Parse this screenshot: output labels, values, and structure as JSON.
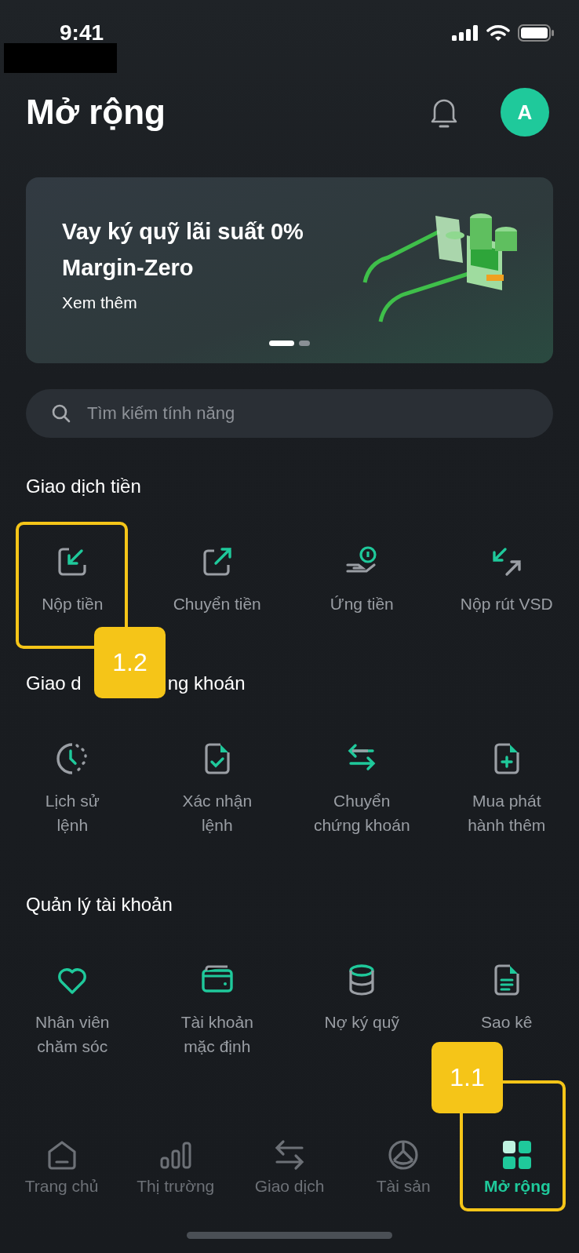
{
  "status_bar": {
    "time": "9:41"
  },
  "header": {
    "title": "Mở rộng",
    "avatar": "A"
  },
  "banner": {
    "title": "Vay ký quỹ lãi suất 0%",
    "subtitle": "Margin-Zero",
    "link": "Xem thêm",
    "pages": [
      {
        "selected": true
      },
      {
        "selected": false
      }
    ]
  },
  "search": {
    "placeholder": "Tìm kiếm tính năng"
  },
  "sections": [
    {
      "title_parts": [
        "Giao dịch tiền"
      ],
      "items": [
        {
          "lines": [
            "Nộp tiền"
          ]
        },
        {
          "lines": [
            "Chuyển tiền"
          ]
        },
        {
          "lines": [
            "Ứng tiền"
          ]
        },
        {
          "lines": [
            "Nộp rút VSD"
          ]
        }
      ]
    },
    {
      "title_parts": [
        "Giao d",
        "ng khoán"
      ],
      "items": [
        {
          "lines": [
            "Lịch sử",
            "lệnh"
          ]
        },
        {
          "lines": [
            "Xác nhận",
            "lệnh"
          ]
        },
        {
          "lines": [
            "Chuyển",
            "chứng khoán"
          ]
        },
        {
          "lines": [
            "Mua phát",
            "hành thêm"
          ]
        }
      ]
    },
    {
      "title_parts": [
        "Quản lý tài khoản"
      ],
      "items": [
        {
          "lines": [
            "Nhân viên",
            "chăm sóc"
          ]
        },
        {
          "lines": [
            "Tài khoản",
            "mặc định"
          ]
        },
        {
          "lines": [
            "Nợ ký quỹ"
          ]
        },
        {
          "lines": [
            "Sao kê"
          ]
        }
      ]
    }
  ],
  "bottom_nav": [
    {
      "label": "Trang chủ",
      "selected": false
    },
    {
      "label": "Thị trường",
      "selected": false
    },
    {
      "label": "Giao dịch",
      "selected": false
    },
    {
      "label": "Tài sản",
      "selected": false
    },
    {
      "label": "Mở rộng",
      "selected": true
    }
  ],
  "annotations": [
    {
      "label": "1.2",
      "kind": "item"
    },
    {
      "label": "1.1",
      "kind": "nav"
    }
  ]
}
